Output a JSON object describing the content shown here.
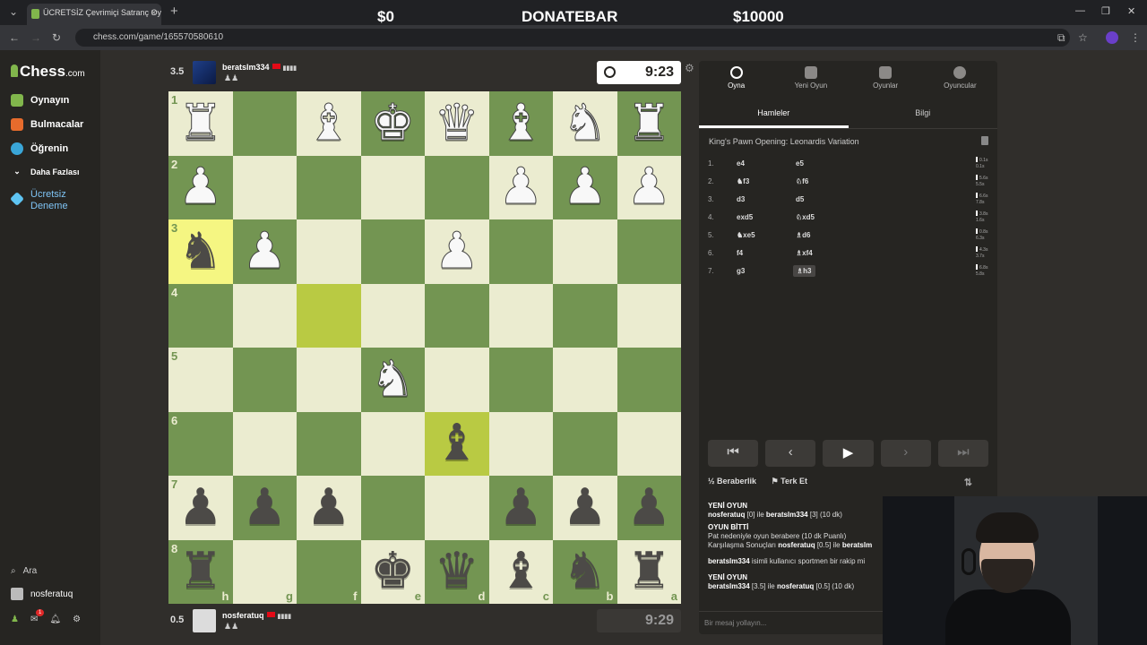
{
  "browser": {
    "tab_title": "ÜCRETSİZ Çevrimiçi Satranç Oy",
    "url": "chess.com/game/165570580610"
  },
  "stream": {
    "donate_left": "$0",
    "donate_title": "DONATEBAR",
    "donate_right": "$10000"
  },
  "sidebar": {
    "logo": "Chess",
    "logo_suffix": ".com",
    "items": [
      {
        "label": "Oynayın",
        "color": "#81b64c"
      },
      {
        "label": "Bulmacalar",
        "color": "#e66b2c"
      },
      {
        "label": "Öğrenin",
        "color": "#3aa6d8"
      }
    ],
    "more": "Daha Fazlası",
    "trial_line1": "Ücretsiz",
    "trial_line2": "Deneme",
    "search": "Ara",
    "user": "nosferatuq",
    "notif_count": "1"
  },
  "top_player": {
    "score": "3.5",
    "name": "beratslm334",
    "clock": "9:23"
  },
  "bottom_player": {
    "score": "0.5",
    "name": "nosferatuq",
    "clock": "9:29"
  },
  "board": {
    "ranks": [
      "1",
      "2",
      "3",
      "4",
      "5",
      "6",
      "7",
      "8"
    ],
    "files": [
      "h",
      "g",
      "f",
      "e",
      "d",
      "c",
      "b",
      "a"
    ],
    "rows": [
      [
        "wR",
        "",
        "wB",
        "wK",
        "wQ",
        "wB",
        "wN",
        "wR"
      ],
      [
        "wP",
        "",
        "",
        "",
        "",
        "wP",
        "wP",
        "wP"
      ],
      [
        "bN",
        "wP",
        "",
        "",
        "wP",
        "",
        "",
        ""
      ],
      [
        "",
        "",
        "",
        "",
        "",
        "",
        "",
        ""
      ],
      [
        "",
        "",
        "",
        "wN",
        "",
        "",
        "",
        ""
      ],
      [
        "",
        "",
        "",
        "",
        "bB",
        "",
        "",
        ""
      ],
      [
        "bP",
        "bP",
        "bP",
        "",
        "",
        "bP",
        "bP",
        "bP"
      ],
      [
        "bR",
        "",
        "",
        "bK",
        "bQ",
        "bB",
        "bN",
        "bR"
      ]
    ],
    "highlights": [
      [
        2,
        0
      ],
      [
        3,
        2
      ],
      [
        5,
        4
      ]
    ]
  },
  "panel": {
    "tabs": [
      "Oyna",
      "Yeni Oyun",
      "Oyunlar",
      "Oyuncular"
    ],
    "subtabs": [
      "Hamleler",
      "Bilgi"
    ],
    "opening": "King's Pawn Opening: Leonardis Variation",
    "moves": [
      {
        "n": "1.",
        "w": "e4",
        "b": "e5",
        "tw": "0.1s",
        "tb": "0.1s"
      },
      {
        "n": "2.",
        "w": "♞f3",
        "b": "♘f6",
        "tw": "5.6s",
        "tb": "5.5s"
      },
      {
        "n": "3.",
        "w": "d3",
        "b": "d5",
        "tw": "6.6s",
        "tb": "7.8s"
      },
      {
        "n": "4.",
        "w": "exd5",
        "b": "♘xd5",
        "tw": "3.8s",
        "tb": "1.6s"
      },
      {
        "n": "5.",
        "w": "♞xe5",
        "b": "♗d6",
        "tw": "0.8s",
        "tb": "6.3s"
      },
      {
        "n": "6.",
        "w": "f4",
        "b": "♗xf4",
        "tw": "4.3s",
        "tb": "3.7s"
      },
      {
        "n": "7.",
        "w": "g3",
        "b": "♗h3",
        "tw": "6.8s",
        "tb": "5.8s"
      }
    ],
    "draw": "Beraberlik",
    "resign": "Terk Et",
    "chat_input": "Bir mesaj yollayın..."
  },
  "chat": {
    "new_game_1": "YENİ OYUN",
    "new_game_1_line_a": "nosferatuq",
    "new_game_1_line_b": " [0] ile ",
    "new_game_1_line_c": "beratslm334",
    "new_game_1_line_d": " [3] (10 dk)",
    "game_over": "OYUN BİTTİ",
    "game_over_line1": "Pat nedeniyle oyun berabere (10 dk Puanlı)",
    "game_over_line2_a": "Karşılaşma Sonuçları ",
    "game_over_line2_b": "nosferatuq",
    "game_over_line2_c": " [0.5] ile ",
    "game_over_line2_d": "beratslm",
    "sportsman_a": "beratslm334",
    "sportsman_b": " isimli kullanıcı sportmen bir rakip mi",
    "new_game_2": "YENİ OYUN",
    "new_game_2_line_a": "beratslm334",
    "new_game_2_line_b": " [3.5] ile ",
    "new_game_2_line_c": "nosferatuq",
    "new_game_2_line_d": " [0.5] (10 dk)"
  },
  "colors": {
    "board_light": "#ebecd0",
    "board_dark": "#739552",
    "highlight_light": "#f5f682",
    "highlight_dark": "#b9ca43",
    "accent": "#81b64c"
  }
}
